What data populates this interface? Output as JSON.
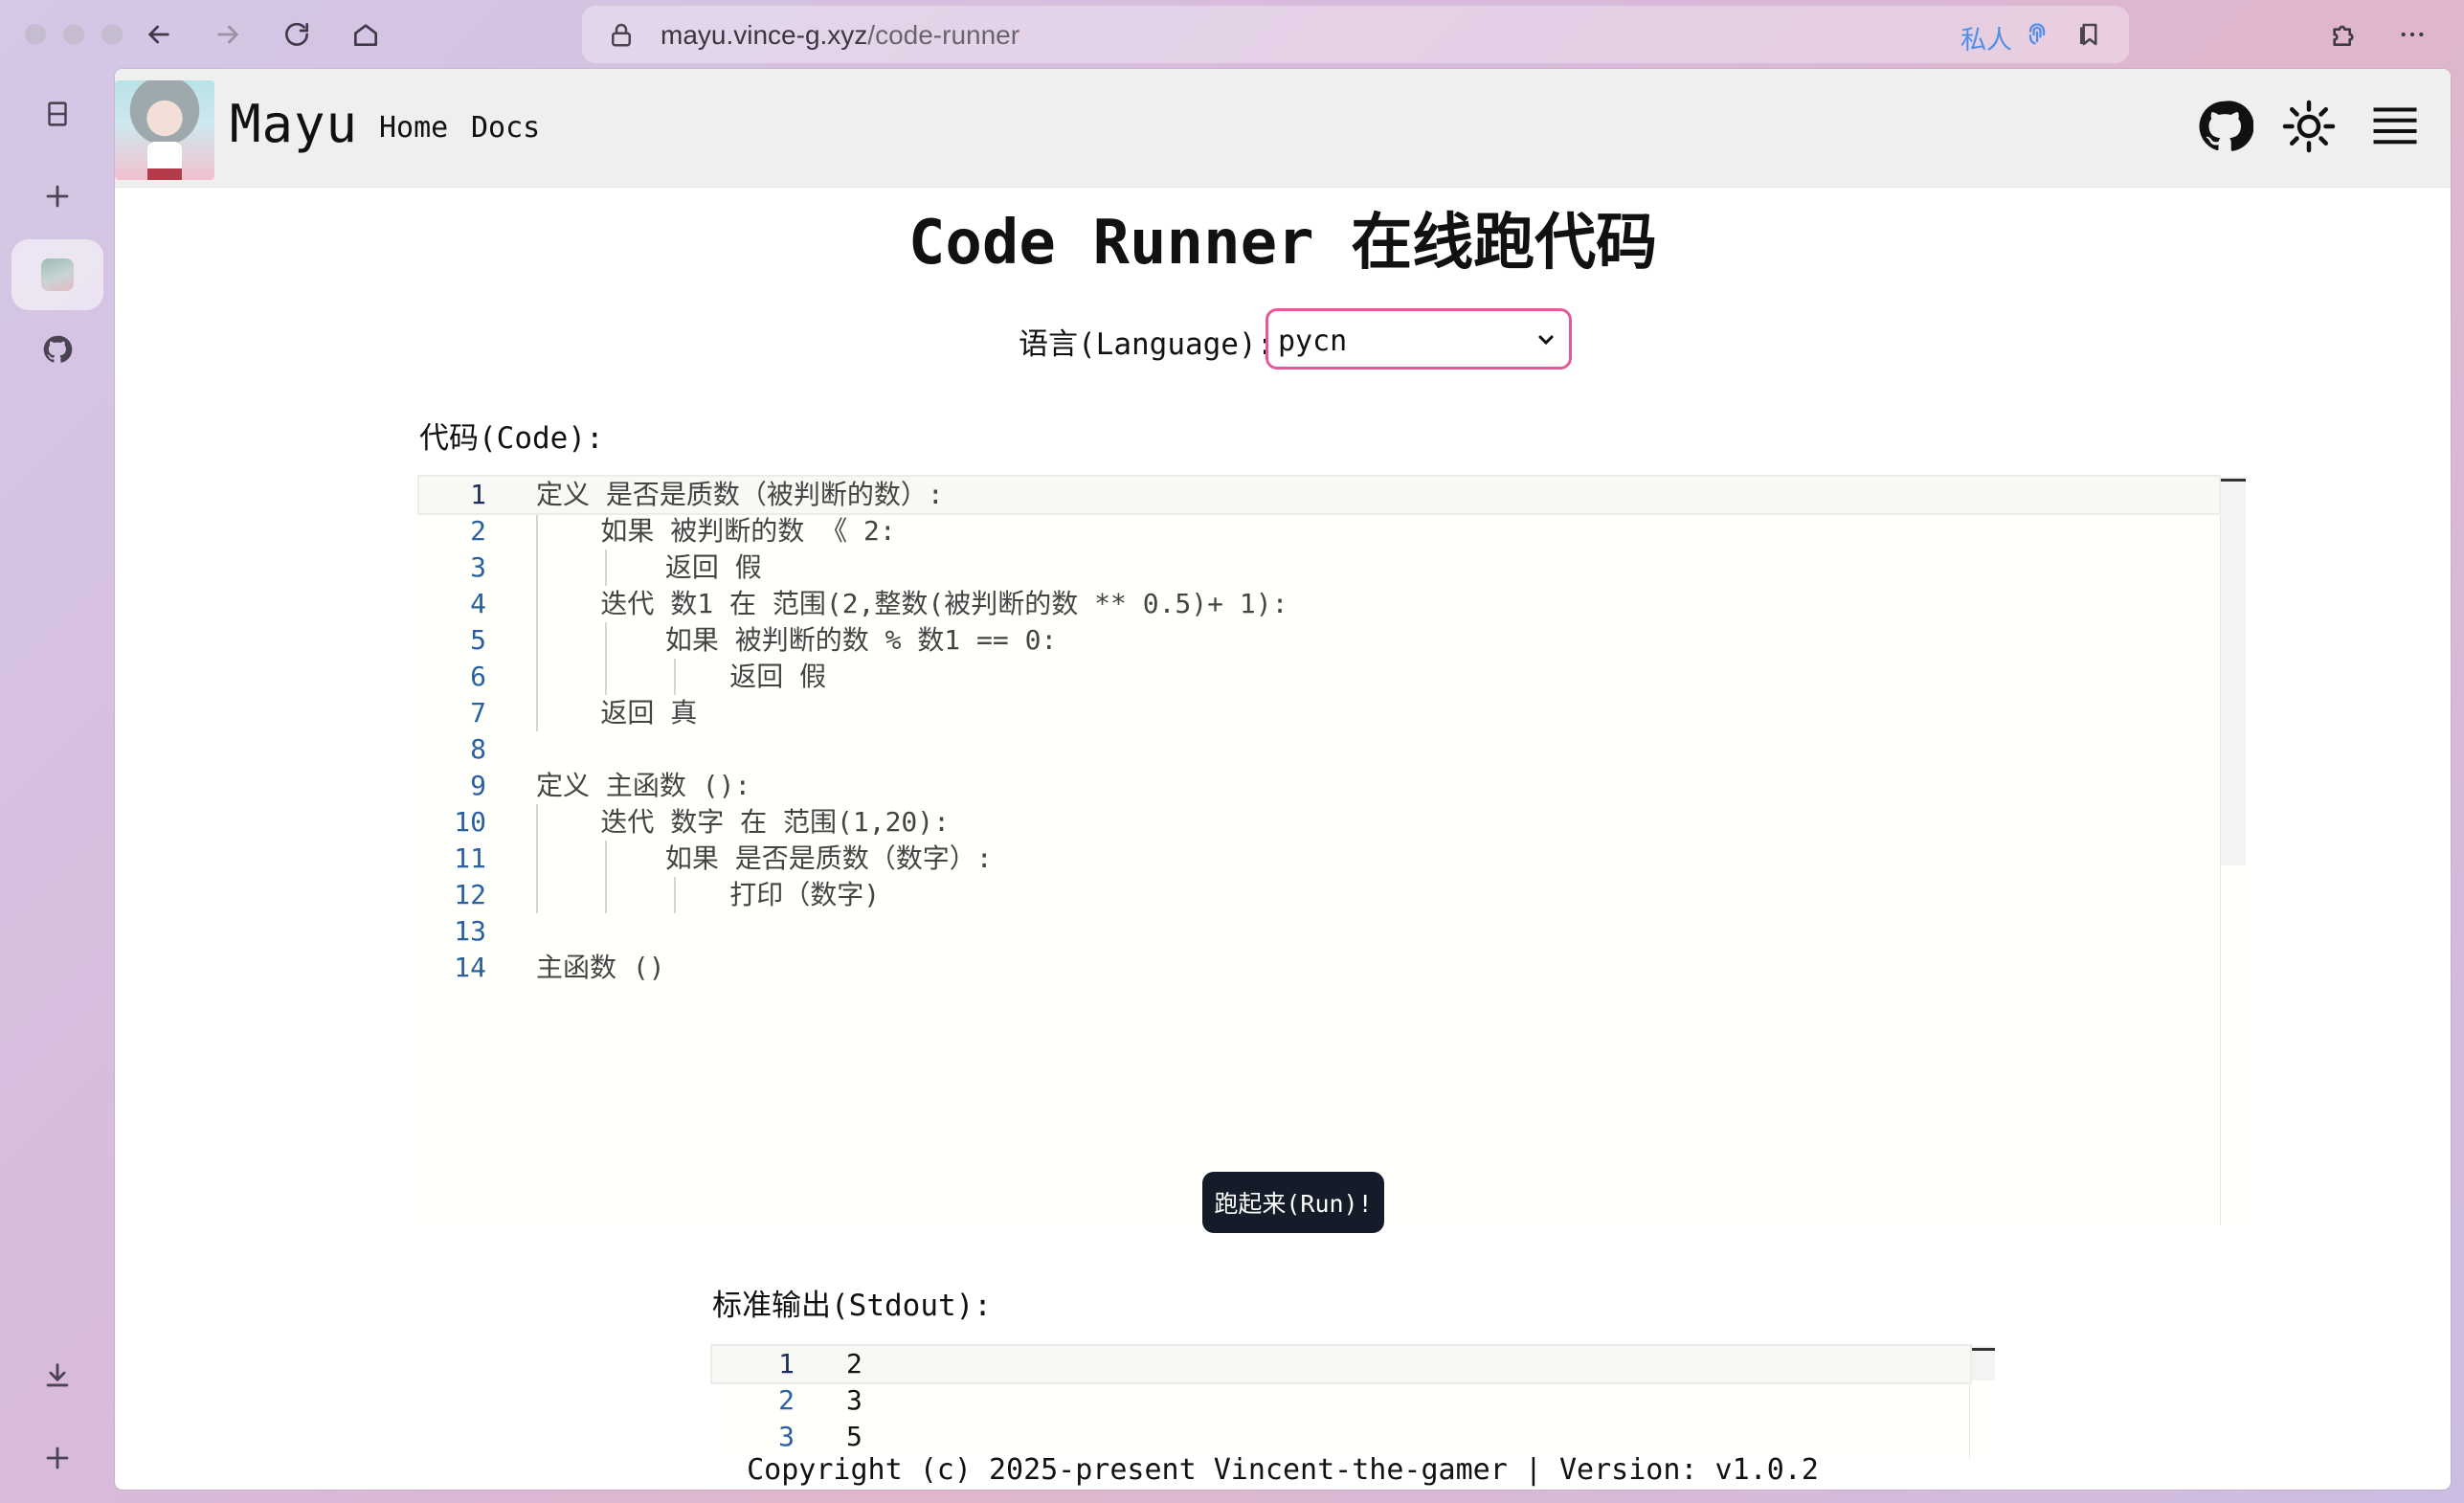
{
  "browser": {
    "url_host": "mayu.vince-g.xyz",
    "url_path": "/code-runner",
    "private_label": "私人"
  },
  "sidebar": {
    "items": [
      {
        "icon": "calendar-icon"
      },
      {
        "icon": "plus-icon"
      },
      {
        "icon": "mayu-avatar-icon"
      },
      {
        "icon": "github-icon"
      },
      {
        "icon": "download-icon"
      },
      {
        "icon": "plus-icon"
      }
    ]
  },
  "header": {
    "site_title": "Mayu",
    "nav": [
      "Home",
      "Docs"
    ]
  },
  "main": {
    "title": "Code Runner 在线跑代码",
    "language_label": "语言(Language):",
    "language_selected": "pycn",
    "code_label": "代码(Code):",
    "code_lines": [
      {
        "n": "1",
        "text": "定义 是否是质数（被判断的数）:"
      },
      {
        "n": "2",
        "text": "    如果 被判断的数 《 2:"
      },
      {
        "n": "3",
        "text": "        返回 假"
      },
      {
        "n": "4",
        "text": "    迭代 数1 在 范围(2,整数(被判断的数 ** 0.5)+ 1):"
      },
      {
        "n": "5",
        "text": "        如果 被判断的数 % 数1 == 0:"
      },
      {
        "n": "6",
        "text": "            返回 假"
      },
      {
        "n": "7",
        "text": "    返回 真"
      },
      {
        "n": "8",
        "text": ""
      },
      {
        "n": "9",
        "text": "定义 主函数 ():"
      },
      {
        "n": "10",
        "text": "    迭代 数字 在 范围(1,20):"
      },
      {
        "n": "11",
        "text": "        如果 是否是质数（数字）:"
      },
      {
        "n": "12",
        "text": "            打印（数字)"
      },
      {
        "n": "13",
        "text": ""
      },
      {
        "n": "14",
        "text": "主函数 ()"
      }
    ],
    "run_label": "跑起来(Run)!",
    "stdout_label": "标准输出(Stdout):",
    "stdout_lines": [
      {
        "n": "1",
        "text": "2"
      },
      {
        "n": "2",
        "text": "3"
      },
      {
        "n": "3",
        "text": "5"
      }
    ]
  },
  "footer": {
    "text": "Copyright (c) 2025-present Vincent-the-gamer | Version: v1.0.2"
  },
  "colors": {
    "select_border": "#e25a96",
    "bracket_highlight": "#d7a34a",
    "run_button": "#141c2a",
    "line_number": "#2a5fa0"
  }
}
